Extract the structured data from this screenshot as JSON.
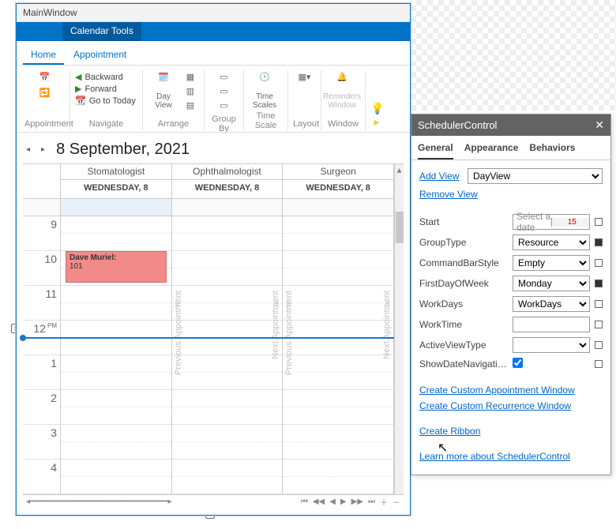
{
  "window": {
    "title": "MainWindow",
    "context_tab": "Calendar Tools"
  },
  "ribbon": {
    "tabs": {
      "home": "Home",
      "appointment": "Appointment"
    },
    "nav": {
      "backward": "Backward",
      "forward": "Forward",
      "today": "Go to Today"
    },
    "dayview": "Day View",
    "timescales": "Time Scales",
    "reminders": "Reminders Window",
    "groups": {
      "appointment": "Appointment",
      "navigate": "Navigate",
      "arrange": "Arrange",
      "groupby": "Group By",
      "timescale": "Time Scale",
      "layout": "Layout",
      "window": "Window"
    }
  },
  "calendar": {
    "date_title": "8 September, 2021",
    "resources": [
      "Stomatologist",
      "Ophthalmologist",
      "Surgeon"
    ],
    "day_header": "WEDNESDAY, 8",
    "hours": [
      "9",
      "10",
      "11",
      "12",
      "1",
      "2",
      "3",
      "4"
    ],
    "pm_marker": "PM",
    "appt": {
      "subject": "Dave Muriel:",
      "room": "101"
    },
    "prev_appt": "Previous Appointment",
    "next_appt": "Next Appointment"
  },
  "panel": {
    "title": "SchedulerControl",
    "tabs": {
      "general": "General",
      "appearance": "Appearance",
      "behaviors": "Behaviors"
    },
    "add_view": "Add View",
    "add_view_value": "DayView",
    "remove_view": "Remove View",
    "props": {
      "start_label": "Start",
      "start_placeholder": "Select a date",
      "grouptype_label": "GroupType",
      "grouptype_value": "Resource",
      "cmdbar_label": "CommandBarStyle",
      "cmdbar_value": "Empty",
      "firstday_label": "FirstDayOfWeek",
      "firstday_value": "Monday",
      "workdays_label": "WorkDays",
      "workdays_value": "WorkDays",
      "worktime_label": "WorkTime",
      "activeview_label": "ActiveViewType",
      "showdatenav_label": "ShowDateNavigatio..."
    },
    "links": {
      "custom_appt": "Create Custom Appointment Window",
      "custom_recur": "Create Custom Recurrence Window",
      "create_ribbon": "Create Ribbon",
      "learn_more": "Learn more about SchedulerControl"
    }
  }
}
